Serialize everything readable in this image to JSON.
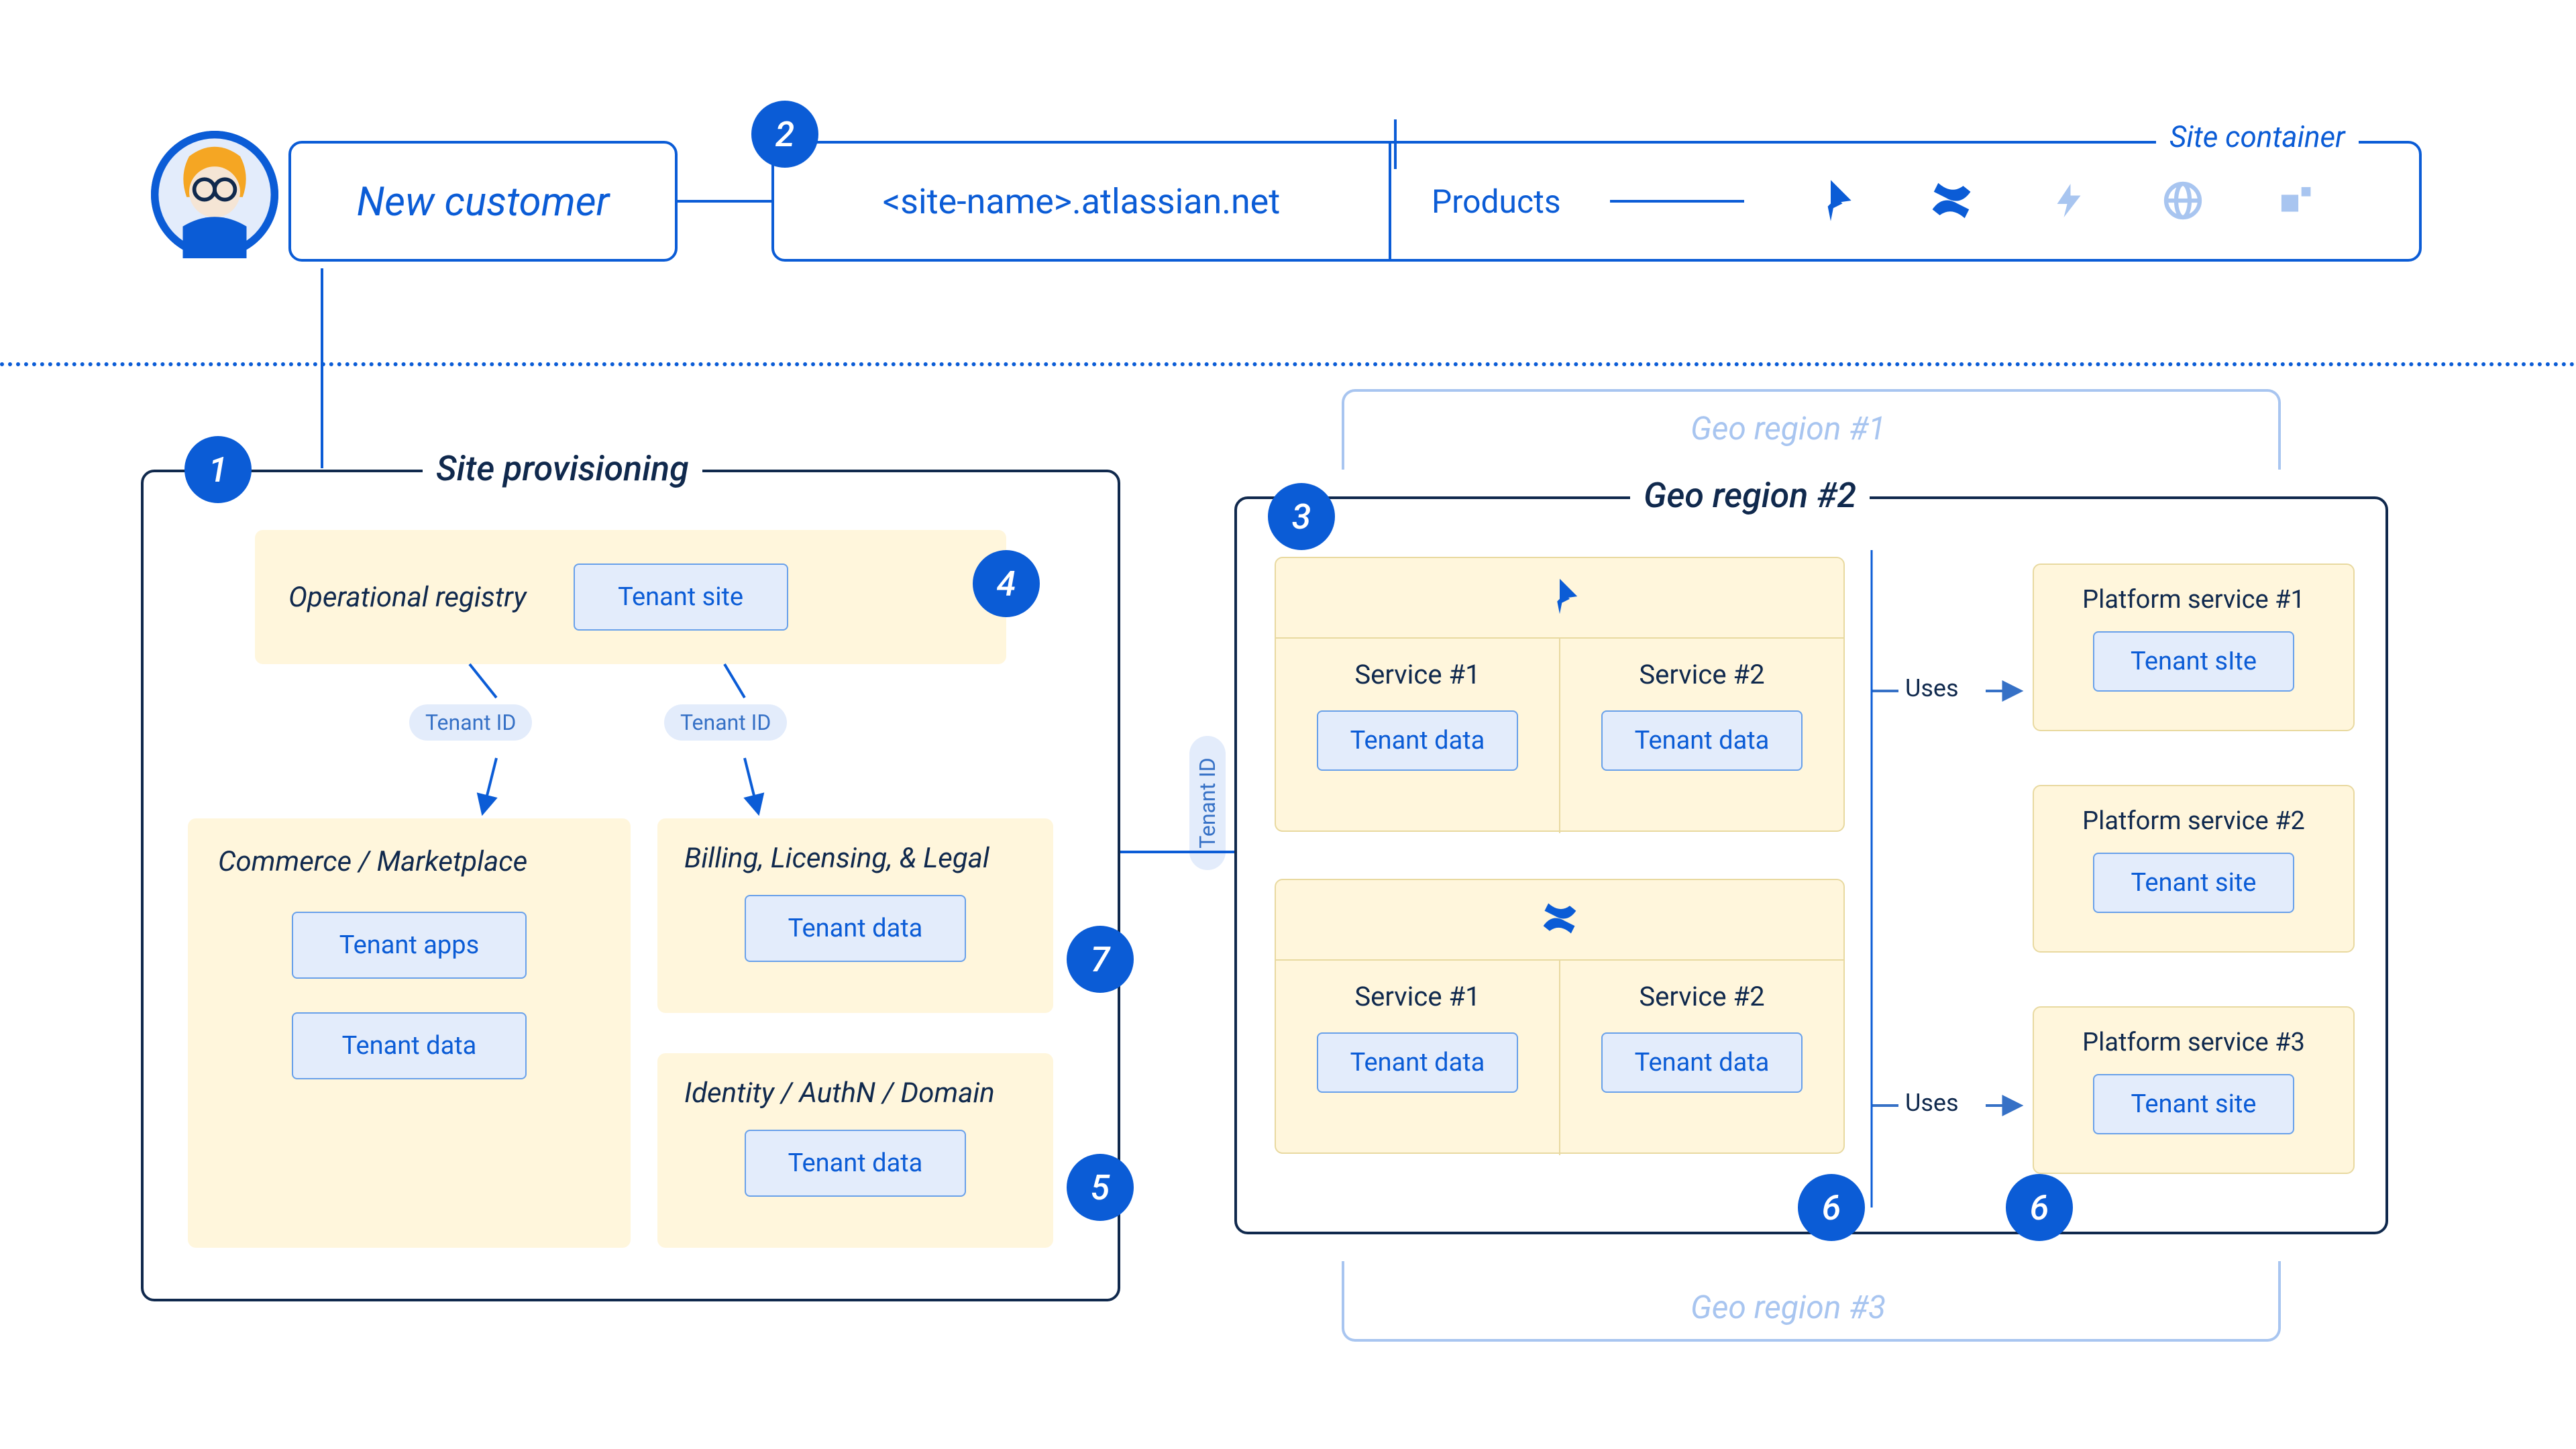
{
  "header": {
    "new_customer": "New customer",
    "site_url": "<site-name>.atlassian.net",
    "site_container": "Site container",
    "products": "Products"
  },
  "badges": {
    "b1": "1",
    "b2": "2",
    "b3": "3",
    "b4": "4",
    "b5": "5",
    "b6": "6",
    "b7": "7"
  },
  "provisioning": {
    "title": "Site provisioning",
    "registry": "Operational registry",
    "tenant_site": "Tenant site",
    "tenant_id": "Tenant ID",
    "commerce": "Commerce / Marketplace",
    "tenant_apps": "Tenant apps",
    "tenant_data": "Tenant data",
    "billing": "Billing, Licensing, & Legal",
    "identity": "Identity / AuthN / Domain"
  },
  "geo": {
    "region1": "Geo region #1",
    "region2": "Geo region #2",
    "region3": "Geo region #3",
    "service1": "Service #1",
    "service2": "Service #2",
    "tenant_data": "Tenant data",
    "uses": "Uses",
    "platform1": "Platform service #1",
    "platform2": "Platform service #2",
    "platform3": "Platform service #3",
    "tenant_site": "Tenant site",
    "tenant_site_typo": "Tenant sIte"
  }
}
